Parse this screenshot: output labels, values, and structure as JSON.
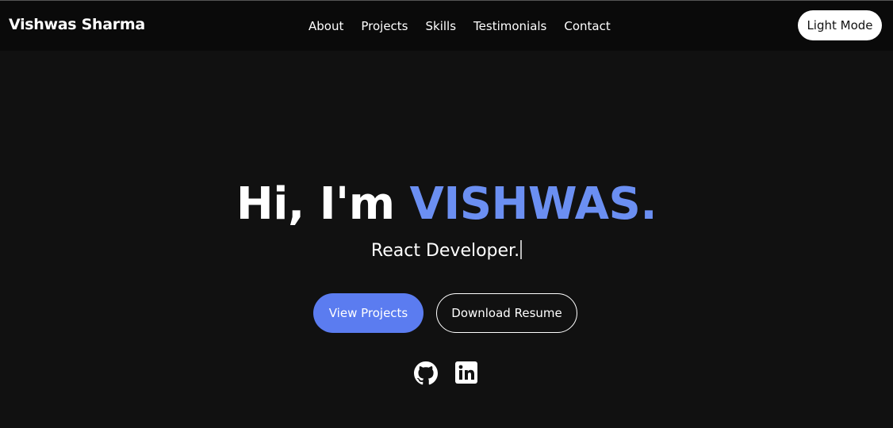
{
  "header": {
    "brand": "Vishwas Sharma",
    "nav": [
      "About",
      "Projects",
      "Skills",
      "Testimonials",
      "Contact"
    ],
    "mode_toggle_label": "Light Mode"
  },
  "hero": {
    "greeting": "Hi, I'm ",
    "name": "VISHWAS.",
    "role": "React Developer.",
    "primary_button": "View Projects",
    "secondary_button": "Download Resume"
  },
  "social": {
    "icons": [
      "github-icon",
      "linkedin-icon"
    ]
  },
  "colors": {
    "background": "#111111",
    "header_background": "#0a0a0a",
    "accent_name": "#6b8ff2",
    "primary_button": "#5b7cf0"
  }
}
